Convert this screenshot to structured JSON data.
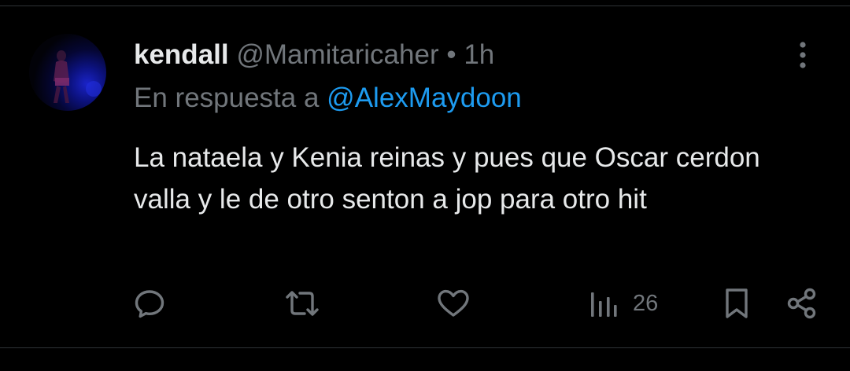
{
  "tweet": {
    "author_name": "kendall",
    "author_handle": "@Mamitaricaher",
    "separator": "•",
    "timestamp": "1h",
    "reply_prefix": "En respuesta a",
    "reply_to": "@AlexMaydoon",
    "text": "La nataela y Kenia reinas y pues que Oscar cerdon valla y le de otro senton a jop para otro hit"
  },
  "actions": {
    "reply_icon": "speech-bubble-icon",
    "retweet_icon": "retweet-arrows-icon",
    "like_icon": "heart-icon",
    "views_icon": "bar-chart-icon",
    "views_count": "26",
    "bookmark_icon": "bookmark-icon",
    "share_icon": "share-icon"
  },
  "colors": {
    "background": "#000000",
    "primary_text": "#e7e9ea",
    "secondary_text": "#71767b",
    "link": "#1d9bf0",
    "divider": "#2f3336"
  }
}
